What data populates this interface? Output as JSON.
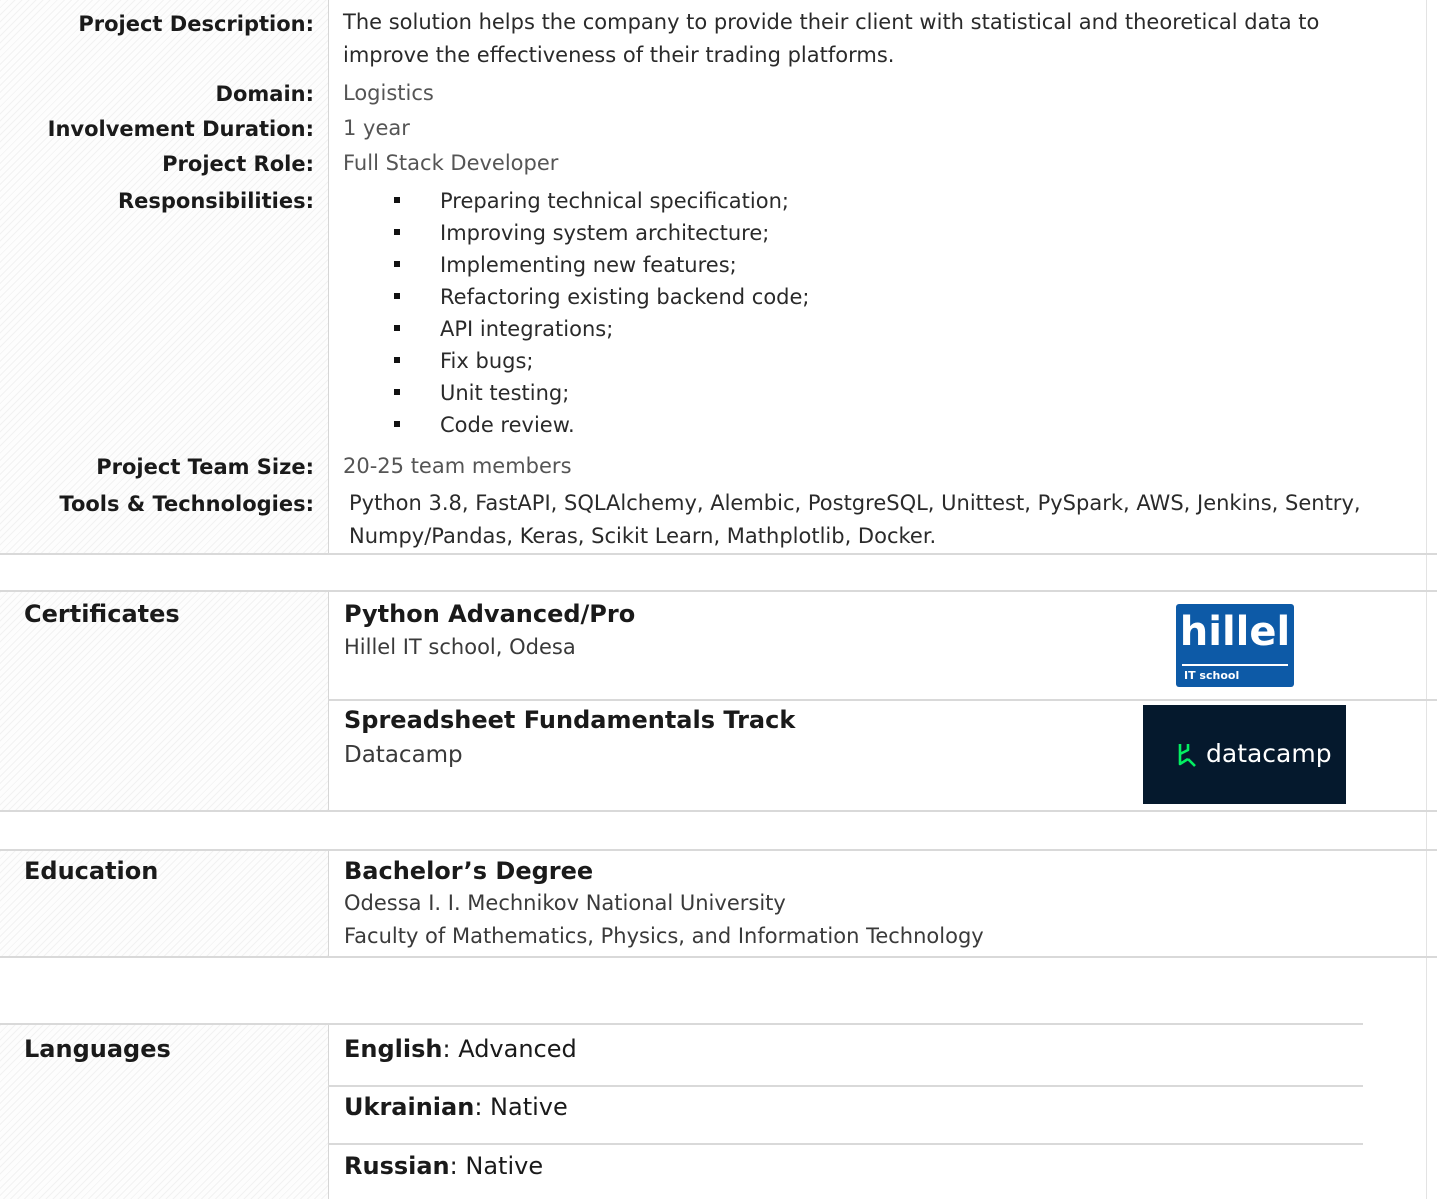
{
  "project": {
    "rows": [
      {
        "label": "Project Description:",
        "value": "The solution helps the company to provide their client with statistical and theoretical data to improve the effectiveness of their trading platforms."
      },
      {
        "label": "Domain:",
        "value": "Logistics"
      },
      {
        "label": "Involvement Duration:",
        "value": "1 year"
      },
      {
        "label": "Project Role:",
        "value": "Full Stack Developer"
      },
      {
        "label": "Responsibilities:"
      },
      {
        "label": "Project Team Size:",
        "value": "20-25 team members"
      },
      {
        "label": "Tools & Technologies:",
        "value": "Python 3.8, FastAPI, SQLAlchemy, Alembic, PostgreSQL, Unittest, PySpark, AWS, Jenkins, Sentry, Numpy/Pandas, Keras, Scikit Learn, Mathplotlib, Docker."
      }
    ],
    "responsibilities": [
      "Preparing technical specification;",
      "Improving system architecture;",
      "Implementing new features;",
      "Refactoring existing backend code;",
      "API integrations;",
      "Fix bugs;",
      "Unit testing;",
      "Code review."
    ]
  },
  "certificates": {
    "title": "Certificates",
    "items": [
      {
        "name": "Python Advanced/Pro",
        "issuer": "Hillel IT school, Odesa",
        "logo_text": "hillel",
        "logo_sub": "IT school",
        "logo_color": "#0d5aa7"
      },
      {
        "name": "Spreadsheet Fundamentals Track",
        "issuer": "Datacamp",
        "logo_text": "datacamp",
        "logo_color": "#05192d",
        "logo_accent": "#03ef62"
      }
    ]
  },
  "education": {
    "title": "Education",
    "degree": "Bachelor’s Degree",
    "university": "Odessa I. I. Mechnikov National University",
    "faculty": "Faculty of Mathematics, Physics, and Information Technology"
  },
  "languages": {
    "title": "Languages",
    "items": [
      {
        "name": "English",
        "level": ": Advanced"
      },
      {
        "name": "Ukrainian",
        "level": ": Native"
      },
      {
        "name": "Russian",
        "level": ": Native"
      }
    ]
  }
}
